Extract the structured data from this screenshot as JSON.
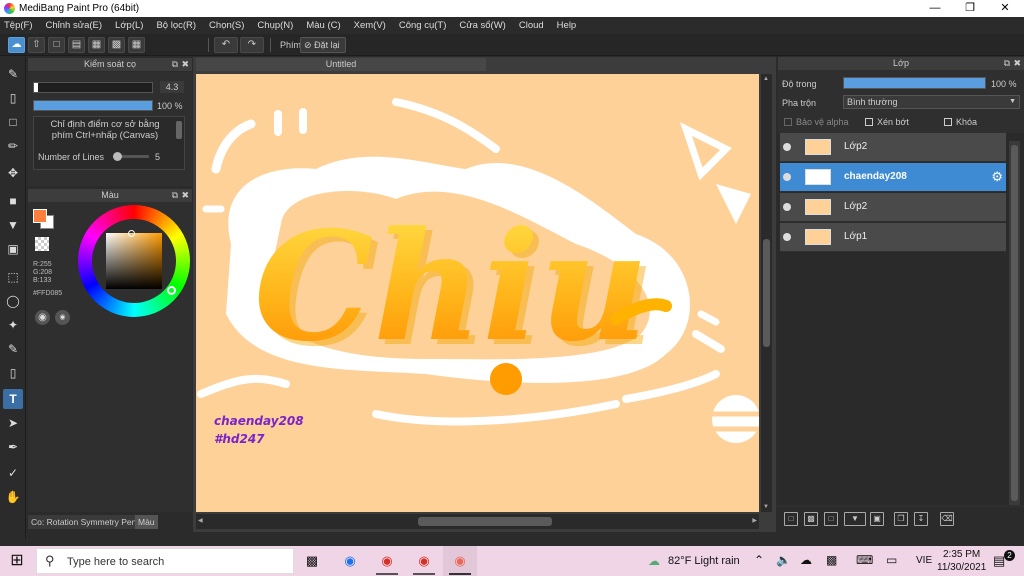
{
  "app": {
    "title": "MediBang Paint Pro (64bit)"
  },
  "menu": [
    "Tệp(F)",
    "Chỉnh sửa(E)",
    "Lớp(L)",
    "Bộ lọc(R)",
    "Chọn(S)",
    "Chụp(N)",
    "Màu (C)",
    "Xem(V)",
    "Công cụ(T)",
    "Cửa sổ(W)",
    "Cloud",
    "Help"
  ],
  "toolbar": {
    "shortcut_label": "Phím",
    "reset_label": "Đặt lại"
  },
  "brush_control": {
    "title": "Kiểm soát cọ",
    "size_value": "4.3",
    "opacity_value": "100 %",
    "size_fraction": 0.03,
    "opacity_fraction": 1.0,
    "note": "Chỉ định điểm cơ sở bằng phím Ctrl+nhấp (Canvas)",
    "lines_label": "Number of Lines",
    "lines_value": "5"
  },
  "color_panel": {
    "title": "Màu",
    "r": "R:255",
    "g": "G:208",
    "b": "B:133",
    "hex": "#FFD085",
    "fg_color": "#ff7f3f",
    "canvas_color": "#fed198"
  },
  "bottom_tabs": {
    "brush_tab": "Co: Rotation Symmetry Pen",
    "color_tab": "Màu"
  },
  "document": {
    "tab": "Untitled"
  },
  "artwork": {
    "main_word": "Chiu",
    "signature_1": "chaenday208",
    "signature_2": "#hd247"
  },
  "layer_panel": {
    "title": "Lớp",
    "opacity_label": "Độ trong",
    "opacity_value": "100 %",
    "opacity_fraction": 1.0,
    "blend_label": "Pha trộn",
    "blend_value": "Bình thường",
    "protect_alpha": "Bảo vệ alpha",
    "clipping": "Xén bớt",
    "lock": "Khóa",
    "layers": [
      {
        "name": "Lớp2",
        "selected": false
      },
      {
        "name": "chaenday208",
        "selected": true
      },
      {
        "name": "Lớp2",
        "selected": false
      },
      {
        "name": "Lớp1",
        "selected": false
      }
    ]
  },
  "taskbar": {
    "search_placeholder": "Type here to search",
    "weather": "82°F  Light rain",
    "language": "VIE",
    "time": "2:35 PM",
    "date": "11/30/2021",
    "notification_count": "2"
  }
}
